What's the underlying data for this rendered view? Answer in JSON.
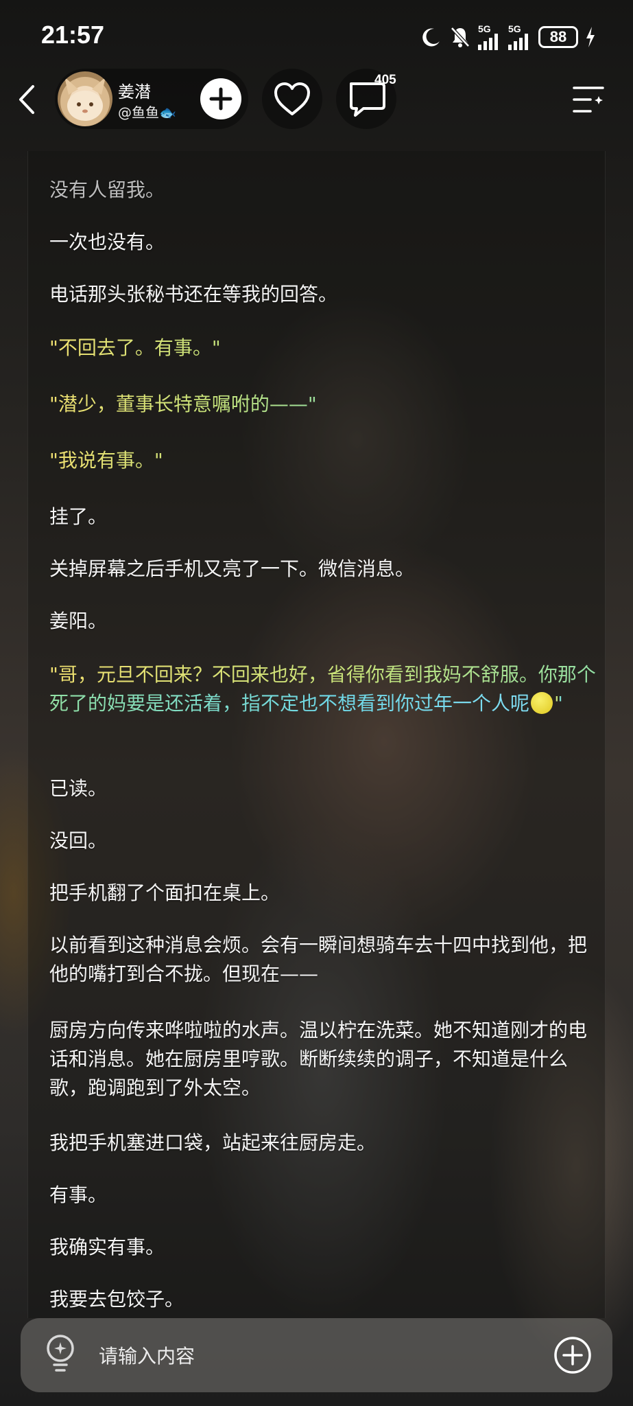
{
  "status_bar": {
    "time": "21:57",
    "network_1": "5G",
    "network_2": "5G",
    "battery": "88",
    "icons": [
      "moon-icon",
      "mute-bell-icon",
      "signal-icon",
      "signal-icon",
      "battery-icon",
      "charging-icon"
    ]
  },
  "header": {
    "author_name": "姜潜",
    "author_handle": "@鱼鱼🐟",
    "comment_count": "405",
    "icons": [
      "back-icon",
      "plus-icon",
      "heart-icon",
      "comment-icon",
      "menu-icon"
    ]
  },
  "article": {
    "p1": "没有人留我。",
    "p2": "一次也没有。",
    "p3": "电话那头张秘书还在等我的回答。",
    "p4": "\"不回去了。有事。\"",
    "p5": "\"潜少，董事长特意嘱咐的——\"",
    "p6": "\"我说有事。\"",
    "p7": "挂了。",
    "p8": "关掉屏幕之后手机又亮了一下。微信消息。",
    "p9": "姜阳。",
    "p10_a": "\"哥，元旦不回来？不回来也好，省得你看到我妈不舒服。你那个死了的妈要是还活着，指不定也不想看到你过年一个人呢",
    "p10_b": "\"",
    "p11": "已读。",
    "p12": "没回。",
    "p13": "把手机翻了个面扣在桌上。",
    "p14": "以前看到这种消息会烦。会有一瞬间想骑车去十四中找到他，把他的嘴打到合不拢。但现在——",
    "p15": "厨房方向传来哗啦啦的水声。温以柠在洗菜。她不知道刚才的电话和消息。她在厨房里哼歌。断断续续的调子，不知道是什么歌，跑调跑到了外太空。",
    "p16": "我把手机塞进口袋，站起来往厨房走。",
    "p17": "有事。",
    "p18": "我确实有事。",
    "p19": "我要去包饺子。"
  },
  "input_bar": {
    "placeholder": "请输入内容",
    "icons": [
      "lightbulb-icon",
      "add-circle-icon"
    ]
  }
}
